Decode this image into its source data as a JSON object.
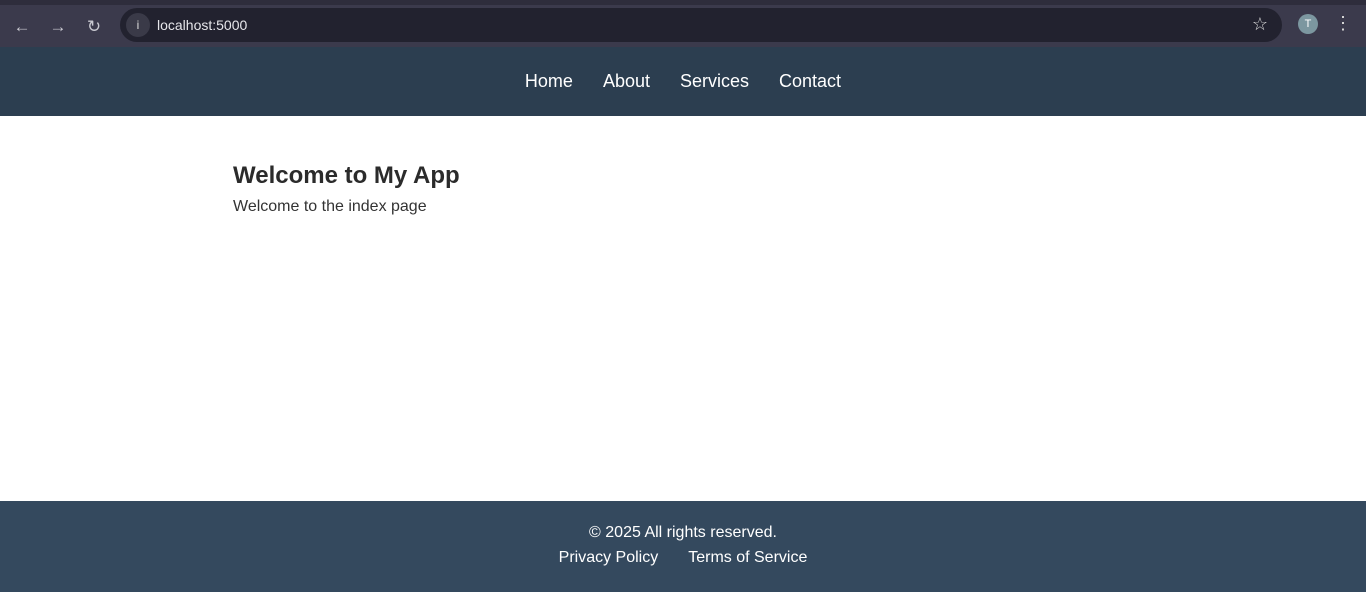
{
  "browser": {
    "url": "localhost:5000",
    "profile_initial": "T"
  },
  "nav": {
    "items": [
      "Home",
      "About",
      "Services",
      "Contact"
    ]
  },
  "main": {
    "title": "Welcome to My App",
    "text": "Welcome to the index page"
  },
  "footer": {
    "copyright": "© 2025 All rights reserved.",
    "links": [
      "Privacy Policy",
      "Terms of Service"
    ]
  },
  "colors": {
    "nav_bg": "#2c3e50",
    "footer_bg": "#34495e"
  }
}
